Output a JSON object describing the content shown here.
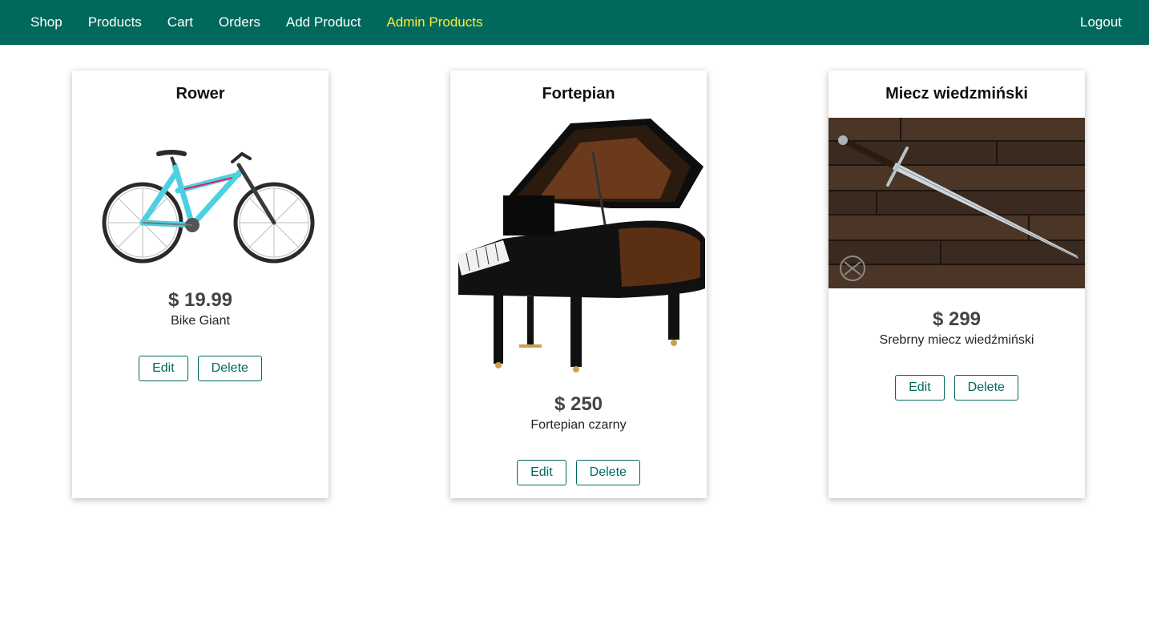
{
  "nav": {
    "items": [
      {
        "label": "Shop",
        "active": false
      },
      {
        "label": "Products",
        "active": false
      },
      {
        "label": "Cart",
        "active": false
      },
      {
        "label": "Orders",
        "active": false
      },
      {
        "label": "Add Product",
        "active": false
      },
      {
        "label": "Admin Products",
        "active": true
      }
    ],
    "logout_label": "Logout"
  },
  "colors": {
    "header_bg": "#00695c",
    "active_nav": "#ffeb3b",
    "button_border": "#00695c"
  },
  "products": [
    {
      "title": "Rower",
      "price": "$ 19.99",
      "description": "Bike Giant",
      "image": "bicycle-image",
      "edit_label": "Edit",
      "delete_label": "Delete"
    },
    {
      "title": "Fortepian",
      "price": "$ 250",
      "description": "Fortepian czarny",
      "image": "grand-piano-image",
      "edit_label": "Edit",
      "delete_label": "Delete"
    },
    {
      "title": "Miecz wiedzmiński",
      "price": "$ 299",
      "description": "Srebrny miecz wiedźmiński",
      "image": "sword-image",
      "edit_label": "Edit",
      "delete_label": "Delete"
    }
  ]
}
